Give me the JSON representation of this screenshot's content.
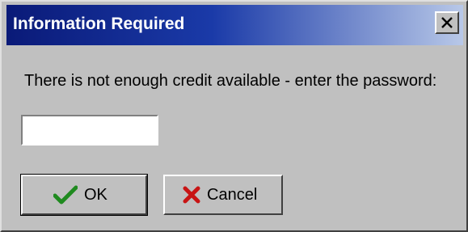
{
  "dialog": {
    "title": "Information Required",
    "message": "There is not enough credit available - enter the password:",
    "password": {
      "value": "",
      "placeholder": ""
    },
    "buttons": {
      "ok_label": "OK",
      "cancel_label": "Cancel"
    },
    "icons": {
      "close": "close-icon",
      "ok": "checkmark-icon",
      "cancel": "red-x-icon"
    },
    "colors": {
      "title_bar_start": "#0a1a78",
      "title_bar_end": "#b8c8e8",
      "face": "#c0c0c0",
      "ok_icon": "#1f8a1f",
      "cancel_icon": "#c81414"
    }
  }
}
